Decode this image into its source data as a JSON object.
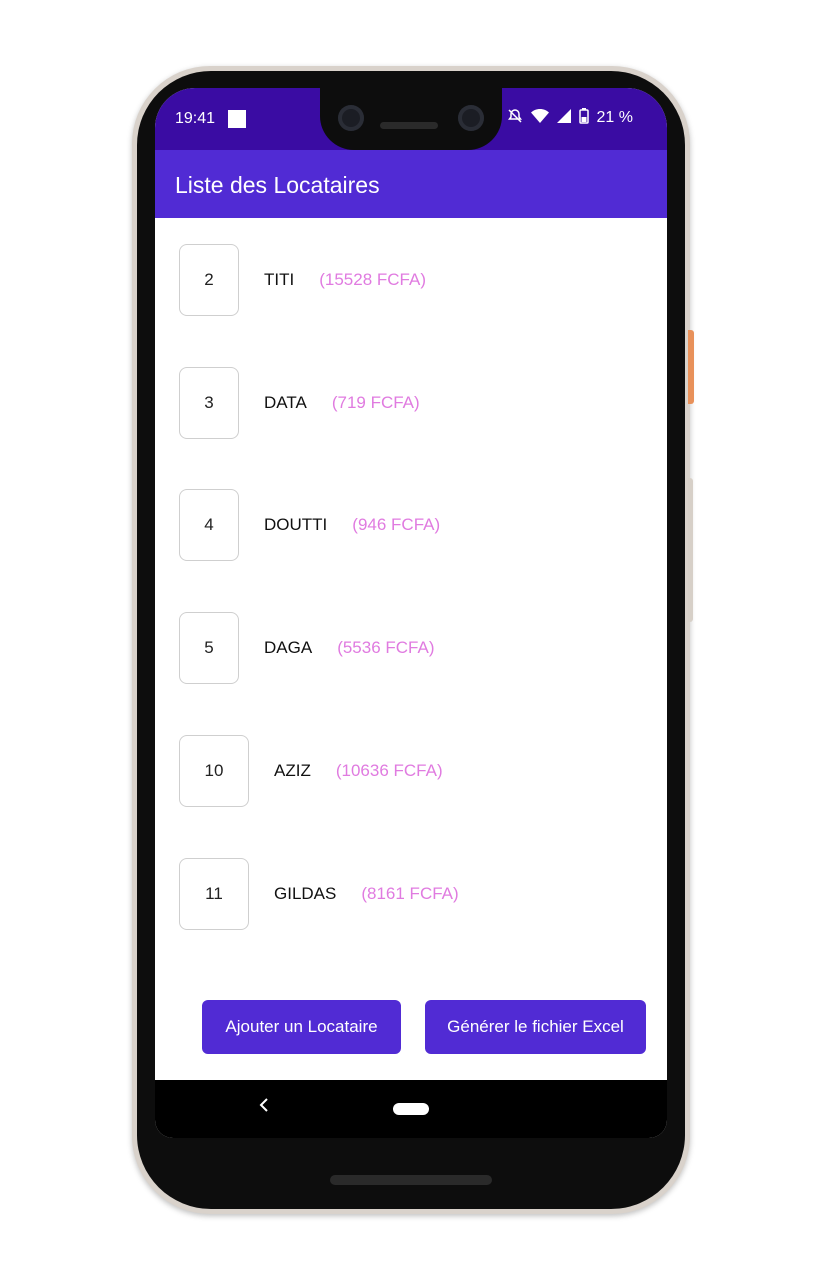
{
  "status_bar": {
    "time": "19:41",
    "battery": "21 %",
    "icons": [
      "notification-square-icon",
      "do-not-disturb-icon",
      "wifi-icon",
      "signal-icon",
      "battery-icon"
    ]
  },
  "app_bar": {
    "title": "Liste des Locataires"
  },
  "tenants": [
    {
      "id": "2",
      "name": "TITI",
      "amount": "(15528 FCFA)"
    },
    {
      "id": "3",
      "name": "DATA",
      "amount": "(719 FCFA)"
    },
    {
      "id": "4",
      "name": "DOUTTI",
      "amount": "(946 FCFA)"
    },
    {
      "id": "5",
      "name": "DAGA",
      "amount": "(5536 FCFA)"
    },
    {
      "id": "10",
      "name": "AZIZ",
      "amount": "(10636 FCFA)"
    },
    {
      "id": "11",
      "name": "GILDAS",
      "amount": "(8161 FCFA)"
    }
  ],
  "actions": {
    "add_label": "Ajouter un Locataire",
    "export_label": "Générer le fichier Excel"
  },
  "colors": {
    "status_bar": "#3a0ca3",
    "primary": "#512bd4",
    "amount": "#e07be0"
  }
}
